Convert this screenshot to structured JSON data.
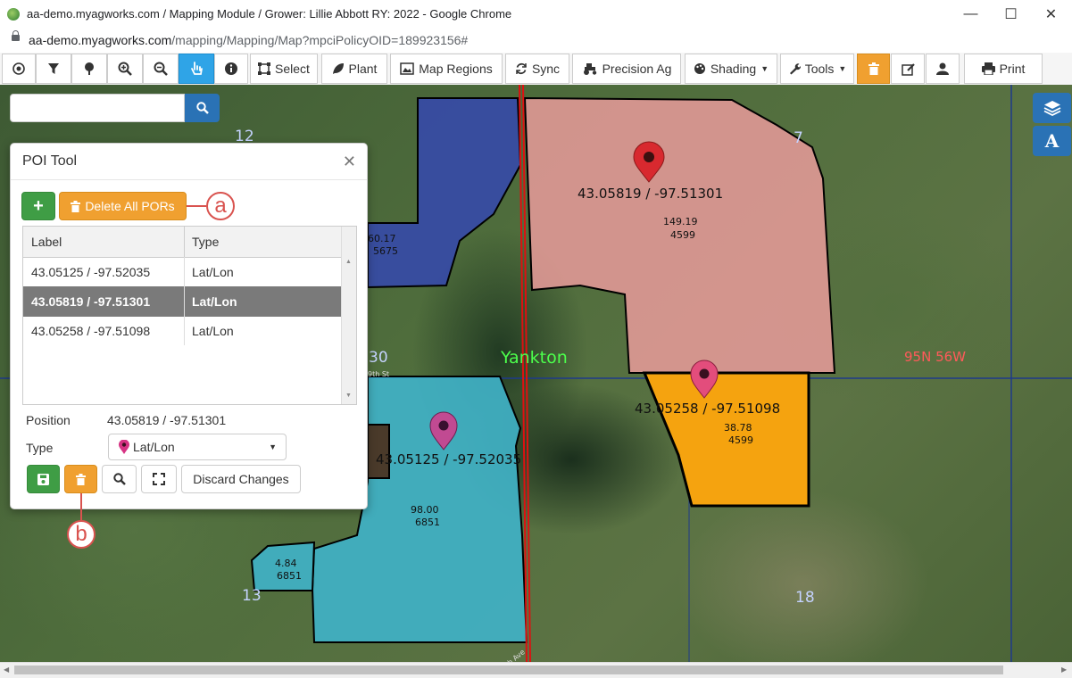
{
  "window": {
    "title": "aa-demo.myagworks.com / Mapping Module / Grower: Lillie Abbott RY: 2022 - Google Chrome",
    "url_host": "aa-demo.myagworks.com",
    "url_path": "/mapping/Mapping/Map?mpciPolicyOID=189923156#"
  },
  "toolbar": {
    "select": "Select",
    "plant": "Plant",
    "map_regions": "Map Regions",
    "sync": "Sync",
    "precision_ag": "Precision Ag",
    "shading": "Shading",
    "tools": "Tools",
    "print": "Print"
  },
  "search": {
    "value": ""
  },
  "poi_panel": {
    "title": "POI Tool",
    "delete_all": "Delete All PORs",
    "columns": [
      "Label",
      "Type"
    ],
    "rows": [
      {
        "label": "43.05125 / -97.52035",
        "type": "Lat/Lon"
      },
      {
        "label": "43.05819 / -97.51301",
        "type": "Lat/Lon"
      },
      {
        "label": "43.05258 / -97.51098",
        "type": "Lat/Lon"
      }
    ],
    "position_label": "Position",
    "position_value": "43.05819 / -97.51301",
    "type_label": "Type",
    "type_value": "Lat/Lon",
    "discard": "Discard Changes"
  },
  "callouts": {
    "a": "a",
    "b": "b"
  },
  "map": {
    "sections": {
      "s12": "12",
      "s7": "7",
      "s30": "30",
      "s13": "13",
      "s18": "18"
    },
    "town": "Yankton",
    "township": "95N 56W",
    "fields": {
      "pink": {
        "acres": "149.19",
        "id": "4599",
        "poi": "43.05819 / -97.51301"
      },
      "orange": {
        "acres": "38.78",
        "id": "4599",
        "poi": "43.05258 / -97.51098"
      },
      "cyan": {
        "acres": "98.00",
        "id": "6851",
        "poi": "43.05125 / -97.52035"
      },
      "small": {
        "acres": "4.84",
        "id": "6851"
      },
      "blue": {
        "acres": "60.17",
        "id": "5675"
      }
    },
    "road_labels": {
      "st": "9th St",
      "ave": "9th Ave"
    }
  },
  "colors": {
    "field_pink": "#e99b9b",
    "field_orange": "#f5a30f",
    "field_cyan": "#3fb2c9",
    "field_blue": "#3346b8",
    "accent_blue": "#2a72b5",
    "accent_orange": "#f0a030",
    "accent_green": "#3f9d45",
    "callout_red": "#d9534f"
  }
}
